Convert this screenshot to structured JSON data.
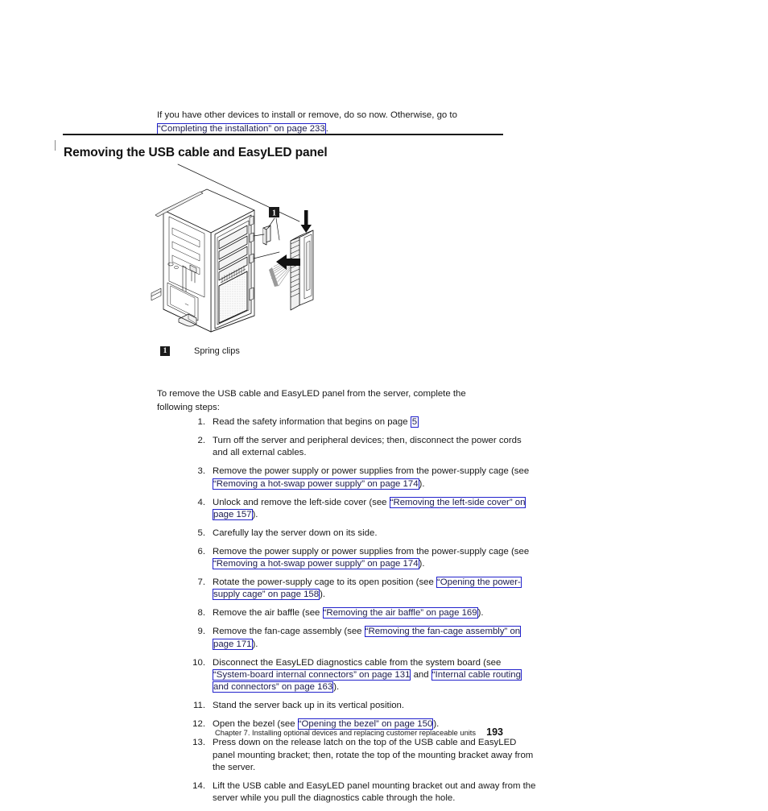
{
  "document": {
    "intro_paragraph": {
      "before": "If you have other devices to install or remove, do so now. Otherwise, go to ",
      "link": "“Completing the installation” on page 233",
      "after": "."
    },
    "section_heading": "Removing the USB cable and EasyLED panel",
    "figure": {
      "name": "server-chassis-usb-easyled-panel-illustration",
      "callout_number": "1"
    },
    "legend": {
      "callout_number": "1",
      "label": "Spring clips"
    },
    "lead_in": "To remove the USB cable and EasyLED panel from the server, complete the following steps:",
    "steps": [
      {
        "number": "1.",
        "parts": [
          {
            "type": "text",
            "value": "Read the safety information that begins on page "
          },
          {
            "type": "link",
            "value": "5"
          }
        ]
      },
      {
        "number": "2.",
        "parts": [
          {
            "type": "text",
            "value": "Turn off the server and peripheral devices; then, disconnect the power cords and all external cables."
          }
        ]
      },
      {
        "number": "3.",
        "parts": [
          {
            "type": "text",
            "value": "Remove the power supply or power supplies from the power-supply cage (see "
          },
          {
            "type": "link",
            "value": "“Removing a hot-swap power supply” on page 174"
          },
          {
            "type": "text",
            "value": ")."
          }
        ]
      },
      {
        "number": "4.",
        "parts": [
          {
            "type": "text",
            "value": "Unlock and remove the left-side cover (see "
          },
          {
            "type": "link",
            "value": "“Removing the left-side cover” on page 157"
          },
          {
            "type": "text",
            "value": ")."
          }
        ]
      },
      {
        "number": "5.",
        "parts": [
          {
            "type": "text",
            "value": "Carefully lay the server down on its side."
          }
        ]
      },
      {
        "number": "6.",
        "parts": [
          {
            "type": "text",
            "value": "Remove the power supply or power supplies from the power-supply cage (see "
          },
          {
            "type": "link",
            "value": "“Removing a hot-swap power supply” on page 174"
          },
          {
            "type": "text",
            "value": ")."
          }
        ]
      },
      {
        "number": "7.",
        "parts": [
          {
            "type": "text",
            "value": "Rotate the power-supply cage to its open position (see "
          },
          {
            "type": "link",
            "value": "“Opening the power-supply cage” on page 158"
          },
          {
            "type": "text",
            "value": ")."
          }
        ]
      },
      {
        "number": "8.",
        "parts": [
          {
            "type": "text",
            "value": "Remove the air baffle (see "
          },
          {
            "type": "link",
            "value": "“Removing the air baffle” on page 169"
          },
          {
            "type": "text",
            "value": ")."
          }
        ]
      },
      {
        "number": "9.",
        "parts": [
          {
            "type": "text",
            "value": "Remove the fan-cage assembly (see "
          },
          {
            "type": "link",
            "value": "“Removing the fan-cage assembly” on page 171"
          },
          {
            "type": "text",
            "value": ")."
          }
        ]
      },
      {
        "number": "10.",
        "parts": [
          {
            "type": "text",
            "value": "Disconnect the EasyLED diagnostics cable from the system board (see "
          },
          {
            "type": "link",
            "value": "“System-board internal connectors” on page 131"
          },
          {
            "type": "text",
            "value": " and "
          },
          {
            "type": "link",
            "value": "“Internal cable routing and connectors” on page 163"
          },
          {
            "type": "text",
            "value": ")."
          }
        ]
      },
      {
        "number": "11.",
        "parts": [
          {
            "type": "text",
            "value": "Stand the server back up in its vertical position."
          }
        ]
      },
      {
        "number": "12.",
        "parts": [
          {
            "type": "text",
            "value": "Open the bezel (see "
          },
          {
            "type": "link",
            "value": "“Opening the bezel” on page 150"
          },
          {
            "type": "text",
            "value": ")."
          }
        ]
      },
      {
        "number": "13.",
        "parts": [
          {
            "type": "text",
            "value": "Press down on the release latch on the top of the USB cable and EasyLED panel mounting bracket; then, rotate the top of the mounting bracket away from the server."
          }
        ]
      },
      {
        "number": "14.",
        "parts": [
          {
            "type": "text",
            "value": "Lift the USB cable and EasyLED panel mounting bracket out and away from the server while you pull the diagnostics cable through the hole."
          }
        ]
      }
    ],
    "footer": {
      "chapter_text": "Chapter 7. Installing optional devices and replacing customer replaceable units",
      "page_number": "193"
    },
    "colors": {
      "link_border": "#2222cc",
      "link_text": "#1b1b4f",
      "body_text": "#1a1a1a",
      "rule": "#1a1a1a"
    }
  }
}
